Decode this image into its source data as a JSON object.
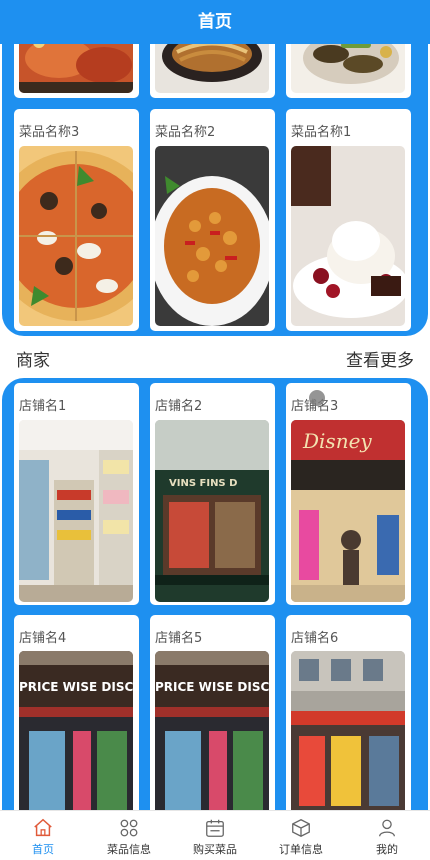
{
  "header": {
    "title": "首页"
  },
  "dishes": [
    {
      "name": "菜品名称3",
      "image": "pizza"
    },
    {
      "name": "菜品名称2",
      "image": "spicy-chicken"
    },
    {
      "name": "菜品名称1",
      "image": "ice-cream-dessert"
    }
  ],
  "shops_section": {
    "title": "商家",
    "more": "查看更多"
  },
  "shops": [
    {
      "name": "店铺名1",
      "image": "supermarket-interior"
    },
    {
      "name": "店铺名2",
      "image": "wine-shop-front"
    },
    {
      "name": "店铺名3",
      "image": "disney-store"
    },
    {
      "name": "店铺名4",
      "image": "price-wise-discount"
    },
    {
      "name": "店铺名5",
      "image": "price-wise-discount"
    },
    {
      "name": "店铺名6",
      "image": "street-storefronts"
    }
  ],
  "shop_sign_texts": {
    "wine": "VINS FINS D",
    "disney": "Disney",
    "pricewise": "PRICE WISE DISCOU"
  },
  "tabs": [
    {
      "label": "首页",
      "icon": "home-icon",
      "active": true
    },
    {
      "label": "菜品信息",
      "icon": "grid-icon",
      "active": false
    },
    {
      "label": "购买菜品",
      "icon": "cart-calendar-icon",
      "active": false
    },
    {
      "label": "订单信息",
      "icon": "box-icon",
      "active": false
    },
    {
      "label": "我的",
      "icon": "user-icon",
      "active": false
    }
  ],
  "colors": {
    "primary": "#1e90f0",
    "tab_active": "#1e90f0"
  }
}
